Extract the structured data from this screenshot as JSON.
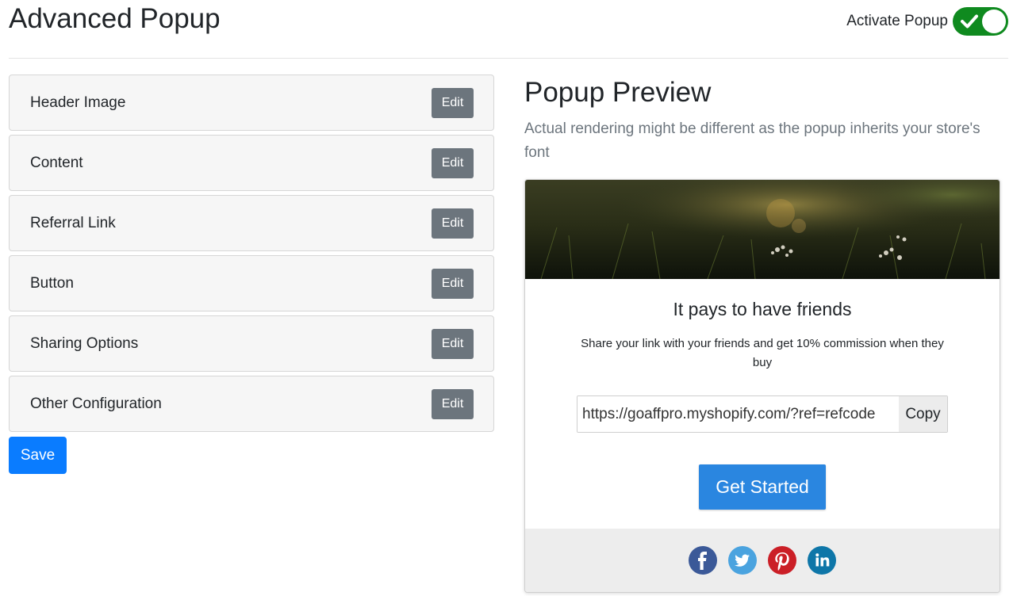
{
  "header": {
    "title": "Advanced Popup",
    "activate_label": "Activate Popup",
    "activate_on": true
  },
  "sections": [
    {
      "label": "Header Image",
      "edit_label": "Edit"
    },
    {
      "label": "Content",
      "edit_label": "Edit"
    },
    {
      "label": "Referral Link",
      "edit_label": "Edit"
    },
    {
      "label": "Button",
      "edit_label": "Edit"
    },
    {
      "label": "Sharing Options",
      "edit_label": "Edit"
    },
    {
      "label": "Other Configuration",
      "edit_label": "Edit"
    }
  ],
  "save_label": "Save",
  "preview": {
    "title": "Popup Preview",
    "subtitle": "Actual rendering might be different as the popup inherits your store's font",
    "popup": {
      "heading": "It pays to have friends",
      "description": "Share your link with your friends and get 10% commission when they buy",
      "referral_link": "https://goaffpro.myshopify.com/?ref=refcode",
      "copy_label": "Copy",
      "cta_label": "Get Started",
      "social_icons": [
        "facebook-icon",
        "twitter-icon",
        "pinterest-icon",
        "linkedin-icon"
      ]
    }
  },
  "colors": {
    "toggle_on": "#0f8a1f",
    "edit_button": "#6c757d",
    "save_button": "#0a7cff",
    "cta_button": "#2a86e0",
    "facebook": "#3b5998",
    "twitter": "#4aa3df",
    "pinterest": "#cb1f27",
    "linkedin": "#0e76a8"
  }
}
